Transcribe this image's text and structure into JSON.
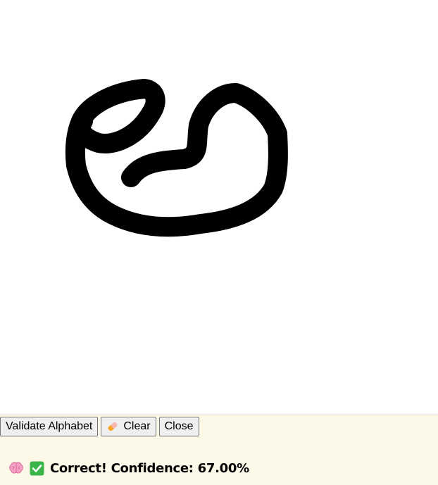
{
  "toolbar": {
    "validate_label": "Validate Alphabet",
    "clear_label": "Clear",
    "close_label": "Close"
  },
  "result": {
    "text": "Correct! Confidence: 67.00%"
  },
  "icons": {
    "clear": "eraser-icon",
    "brain": "brain-icon",
    "check": "check-mark-icon"
  },
  "colors": {
    "panel_bg": "#fdf9e8",
    "canvas_bg": "#ffffff",
    "stroke": "#000000",
    "check_green": "#3bb54a"
  }
}
